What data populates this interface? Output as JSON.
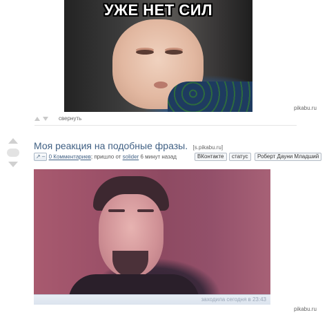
{
  "top_meme": {
    "caption": "УЖЕ НЕТ СИЛ",
    "watermark": "pikabu.ru"
  },
  "collapse": {
    "label": "свернуть"
  },
  "post": {
    "rating": "",
    "title": "Моя реакция на подобные фразы.",
    "domain": "[s.pikabu.ru]",
    "vk_button": "↗ –",
    "comments": "0 Комментариев",
    "sent_by_prefix": "; пришло от",
    "author": "solider",
    "time": "6 минут назад",
    "tags": [
      "ВКонтакте",
      "статус",
      "Роберт Дауни Младший"
    ]
  },
  "gif": {
    "status": "заходила сегодня в 23:43",
    "watermark": "pikabu.ru"
  }
}
